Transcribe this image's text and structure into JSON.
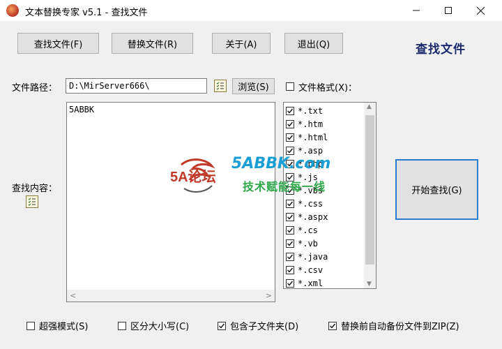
{
  "window": {
    "title": "文本替换专家 v5.1  -  查找文件",
    "mode_title": "查找文件"
  },
  "toolbar": {
    "find_file": "查找文件(F)",
    "replace_file": "替换文件(R)",
    "about": "关于(A)",
    "exit": "退出(Q)"
  },
  "path": {
    "label": "文件路径：",
    "value": "D:\\MirServer666\\",
    "browse": "浏览(S)"
  },
  "file_format": {
    "label": "文件格式(X)：",
    "checked": false,
    "items": [
      {
        "ext": "*.txt",
        "checked": true
      },
      {
        "ext": "*.htm",
        "checked": true
      },
      {
        "ext": "*.html",
        "checked": true
      },
      {
        "ext": "*.asp",
        "checked": true
      },
      {
        "ext": "*.php",
        "checked": true
      },
      {
        "ext": "*.js",
        "checked": true
      },
      {
        "ext": "*.vbs",
        "checked": true
      },
      {
        "ext": "*.css",
        "checked": true
      },
      {
        "ext": "*.aspx",
        "checked": true
      },
      {
        "ext": "*.cs",
        "checked": true
      },
      {
        "ext": "*.vb",
        "checked": true
      },
      {
        "ext": "*.java",
        "checked": true
      },
      {
        "ext": "*.csv",
        "checked": true
      },
      {
        "ext": "*.xml",
        "checked": true
      }
    ]
  },
  "content": {
    "label": "查找内容：",
    "value": "5ABBK"
  },
  "start_button": "开始查找(G)",
  "options": {
    "super_mode": {
      "label": "超强模式(S)",
      "checked": false
    },
    "case_sensitive": {
      "label": "区分大小写(C)",
      "checked": false
    },
    "subfolders": {
      "label": "包含子文件夹(D)",
      "checked": true
    },
    "backup": {
      "label": "替换前自动备份文件到ZIP(Z)",
      "checked": true
    }
  },
  "watermark": {
    "logo_text": "5A论坛",
    "site": "5ABBK.com",
    "slogan": "技术赋能每一线"
  },
  "colors": {
    "accent_border": "#2b7bd2",
    "mode_title": "#1a2a6c",
    "watermark_blue": "#1a9ed6",
    "watermark_green": "#2ea84a"
  }
}
